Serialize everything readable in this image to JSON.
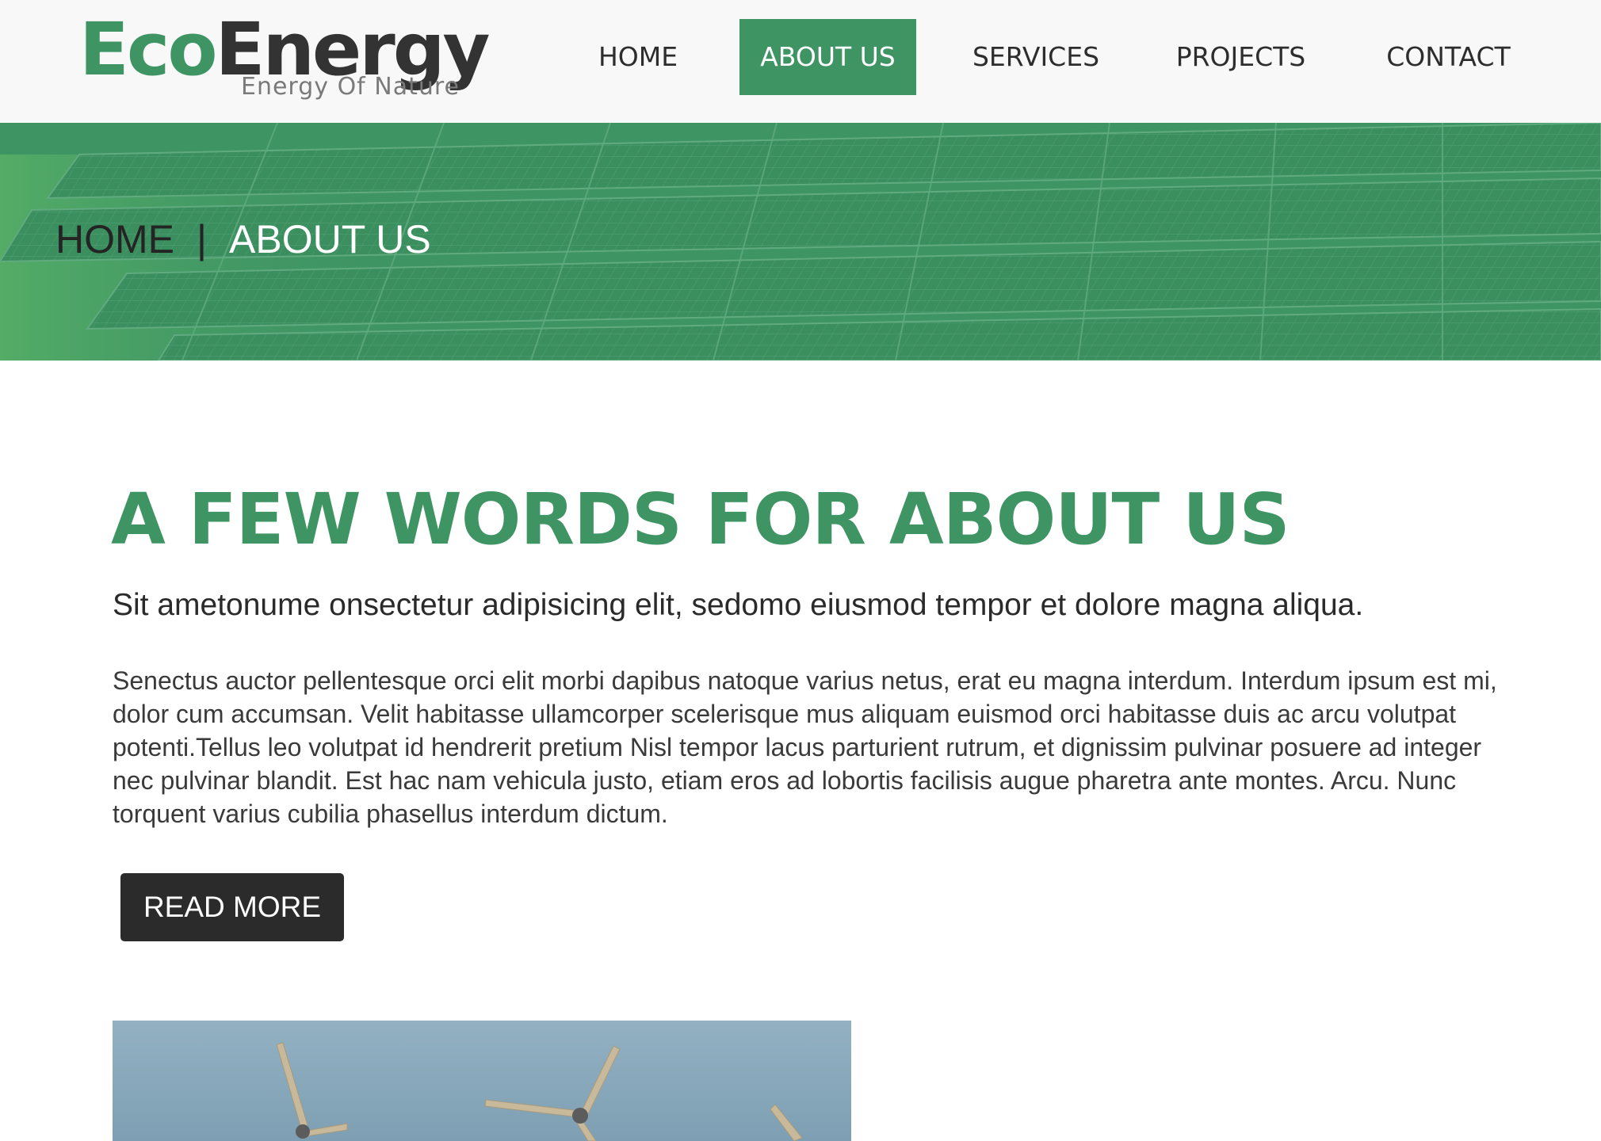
{
  "brand": {
    "name_part1": "Eco",
    "name_part2": "Energy",
    "tagline": "Energy Of Nature",
    "accent_color": "#3f9464",
    "dark_color": "#2b2b2b"
  },
  "nav": {
    "items": [
      {
        "label": "HOME",
        "active": false
      },
      {
        "label": "ABOUT US",
        "active": true
      },
      {
        "label": "SERVICES",
        "active": false
      },
      {
        "label": "PROJECTS",
        "active": false
      },
      {
        "label": "CONTACT",
        "active": false
      }
    ]
  },
  "banner": {
    "breadcrumb_home": "HOME",
    "breadcrumb_separator": "|",
    "breadcrumb_current": "ABOUT US"
  },
  "main": {
    "title": "A FEW WORDS FOR ABOUT US",
    "subtitle": "Sit ametonume onsectetur adipisicing elit, sedomo eiusmod tempor et dolore magna aliqua.",
    "body": "Senectus auctor pellentesque orci elit morbi dapibus natoque varius netus, erat eu magna interdum. Interdum ipsum est mi, dolor cum accumsan. Velit habitasse ullamcorper scelerisque mus aliquam euismod orci habitasse duis ac arcu volutpat potenti.Tellus leo volutpat id hendrerit pretium Nisl tempor lacus parturient rutrum, et dignissim pulvinar posuere ad integer nec pulvinar blandit. Est hac nam vehicula justo, etiam eros ad lobortis facilisis augue pharetra ante montes. Arcu. Nunc torquent varius cubilia phasellus interdum dictum.",
    "read_more_label": "READ MORE"
  }
}
